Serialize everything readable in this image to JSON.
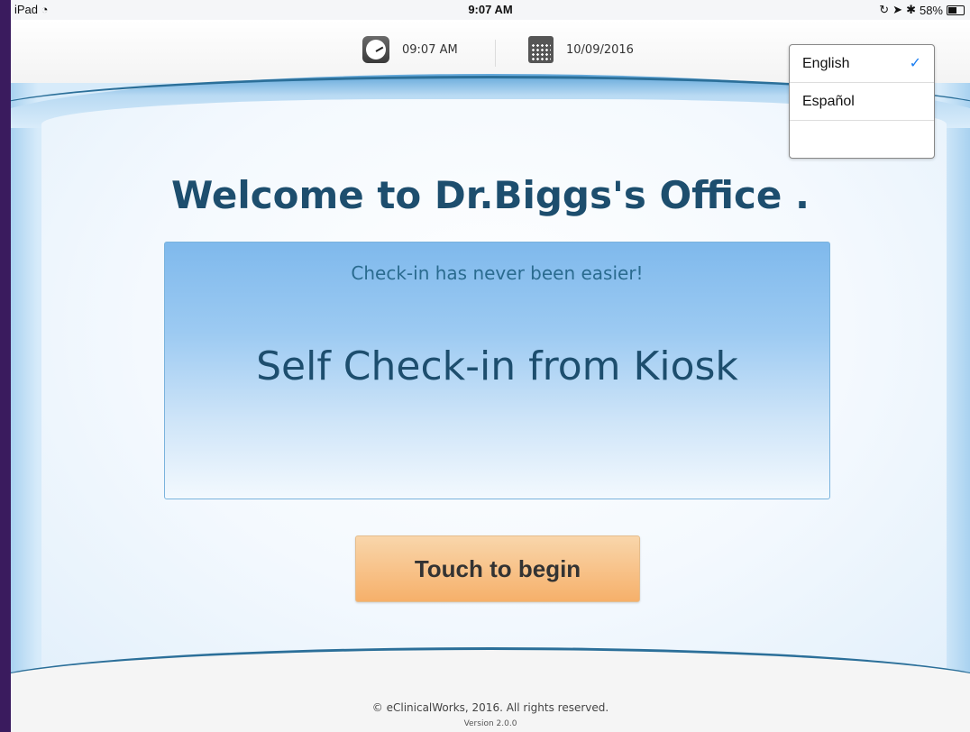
{
  "status_bar": {
    "device": "iPad",
    "wifi_icon": "wifi-icon",
    "time": "9:07 AM",
    "battery": "58%",
    "battery_level": 0.58
  },
  "header": {
    "time": "09:07 AM",
    "date": "10/09/2016"
  },
  "main": {
    "welcome": "Welcome to Dr.Biggs's Office .",
    "tagline": "Check-in has never been easier!",
    "headline": "Self Check-in from Kiosk",
    "begin_button": "Touch to begin"
  },
  "language_menu": {
    "items": [
      {
        "label": "English",
        "selected": true
      },
      {
        "label": "Español",
        "selected": false
      },
      {
        "label": "",
        "selected": false
      }
    ],
    "check": "✓"
  },
  "footer": {
    "copyright": "© eClinicalWorks, 2016. All rights reserved.",
    "version": "Version 2.0.0"
  },
  "colors": {
    "title": "#1d4e6e",
    "accent_blue": "#7fb9ec",
    "button_orange": "#f6b06a",
    "check_blue": "#1a7ef2"
  }
}
